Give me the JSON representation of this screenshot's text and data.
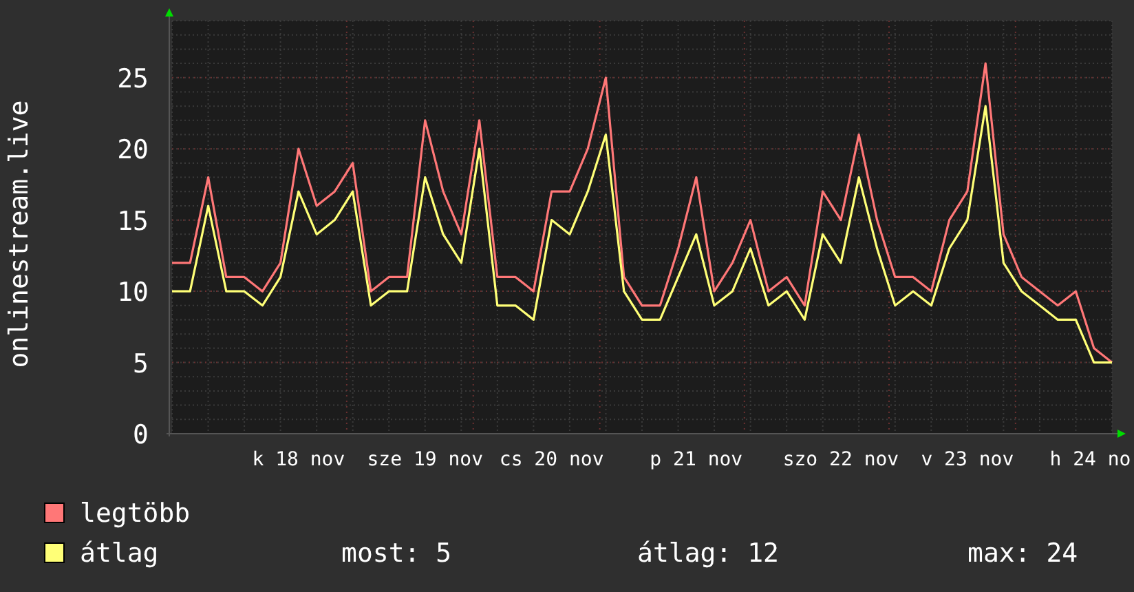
{
  "chart_data": {
    "type": "line",
    "grid": true,
    "ylabel": "onlinestream.live",
    "categories": [
      null,
      null,
      null,
      null,
      null,
      null,
      null,
      "k 18 nov",
      null,
      null,
      null,
      null,
      null,
      null,
      "sze 19 nov",
      null,
      null,
      null,
      null,
      null,
      null,
      "cs 20 nov",
      null,
      null,
      null,
      null,
      null,
      null,
      null,
      "p 21 nov",
      null,
      null,
      null,
      null,
      null,
      null,
      null,
      "szo 22 nov",
      null,
      null,
      null,
      null,
      null,
      null,
      "v 23 nov",
      null,
      null,
      null,
      null,
      null,
      null,
      "h 24 no",
      null
    ],
    "series": [
      {
        "name": "legtöbb",
        "color": "#ff7777",
        "values": [
          12,
          12,
          18,
          11,
          11,
          10,
          12,
          20,
          16,
          17,
          19,
          10,
          11,
          11,
          22,
          17,
          14,
          22,
          11,
          11,
          10,
          17,
          17,
          20,
          25,
          11,
          9,
          9,
          13,
          18,
          10,
          12,
          15,
          10,
          11,
          9,
          17,
          15,
          21,
          15,
          11,
          11,
          10,
          15,
          17,
          26,
          14,
          11,
          10,
          9,
          10,
          6,
          5
        ]
      },
      {
        "name": "átlag",
        "color": "#ffff77",
        "values": [
          10,
          10,
          16,
          10,
          10,
          9,
          11,
          17,
          14,
          15,
          17,
          9,
          10,
          10,
          18,
          14,
          12,
          20,
          9,
          9,
          8,
          15,
          14,
          17,
          21,
          10,
          8,
          8,
          11,
          14,
          9,
          10,
          13,
          9,
          10,
          8,
          14,
          12,
          18,
          13,
          9,
          10,
          9,
          13,
          15,
          23,
          12,
          10,
          9,
          8,
          8,
          5,
          5
        ]
      }
    ],
    "ylim": [
      0,
      29
    ],
    "yticks": [
      0,
      5,
      10,
      15,
      20,
      25
    ]
  },
  "stats": [
    {
      "label": "most:",
      "value": "5"
    },
    {
      "label": "átlag:",
      "value": "12"
    },
    {
      "label": "max:",
      "value": "24"
    }
  ]
}
